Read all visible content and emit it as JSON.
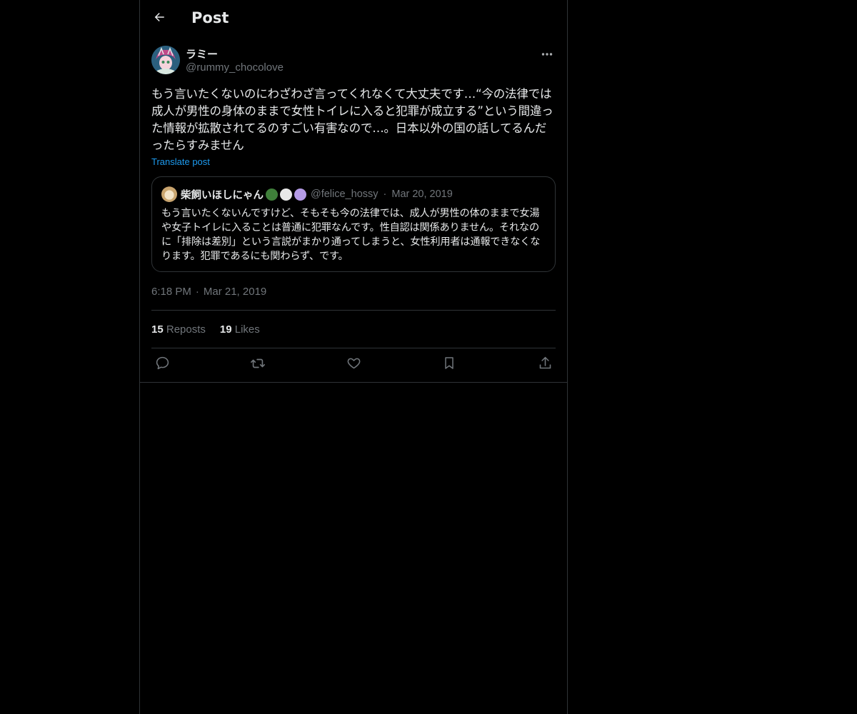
{
  "header": {
    "title": "Post",
    "back_icon": "arrow-left-icon"
  },
  "post": {
    "author": {
      "display_name": "ラミー",
      "handle": "@rummy_chocolove"
    },
    "text": "もう言いたくないのにわざわざ言ってくれなくて大丈夫です…“今の法律では成人が男性の身体のままで女性トイレに入ると犯罪が成立する”という間違った情報が拡散されてるのすごい有害なので…。日本以外の国の話してるんだったらすみません",
    "translate_label": "Translate post",
    "quote": {
      "display_name": "柴飼いほしにゃん",
      "emoji_colors": [
        "#3f7f3a",
        "#e8e8e8",
        "#b59be6"
      ],
      "handle": "@felice_hossy",
      "separator": "·",
      "date": "Mar 20, 2019",
      "text": "もう言いたくないんですけど、そもそも今の法律では、成人が男性の体のままで女湯や女子トイレに入ることは普通に犯罪なんです。性自認は関係ありません。それなのに「排除は差別」という言説がまかり通ってしまうと、女性利用者は通報できなくなります。犯罪であるにも関わらず、です。"
    },
    "time": "6:18 PM",
    "separator": "·",
    "date": "Mar 21, 2019",
    "stats": {
      "reposts_count": "15",
      "reposts_label": "Reposts",
      "likes_count": "19",
      "likes_label": "Likes"
    },
    "actions": [
      "reply-icon",
      "repost-icon",
      "like-icon",
      "bookmark-icon",
      "share-icon"
    ]
  },
  "colors": {
    "background": "#000000",
    "text": "#e7e9ea",
    "muted": "#71767b",
    "accent": "#1d9bf0",
    "border": "#2f3336"
  }
}
